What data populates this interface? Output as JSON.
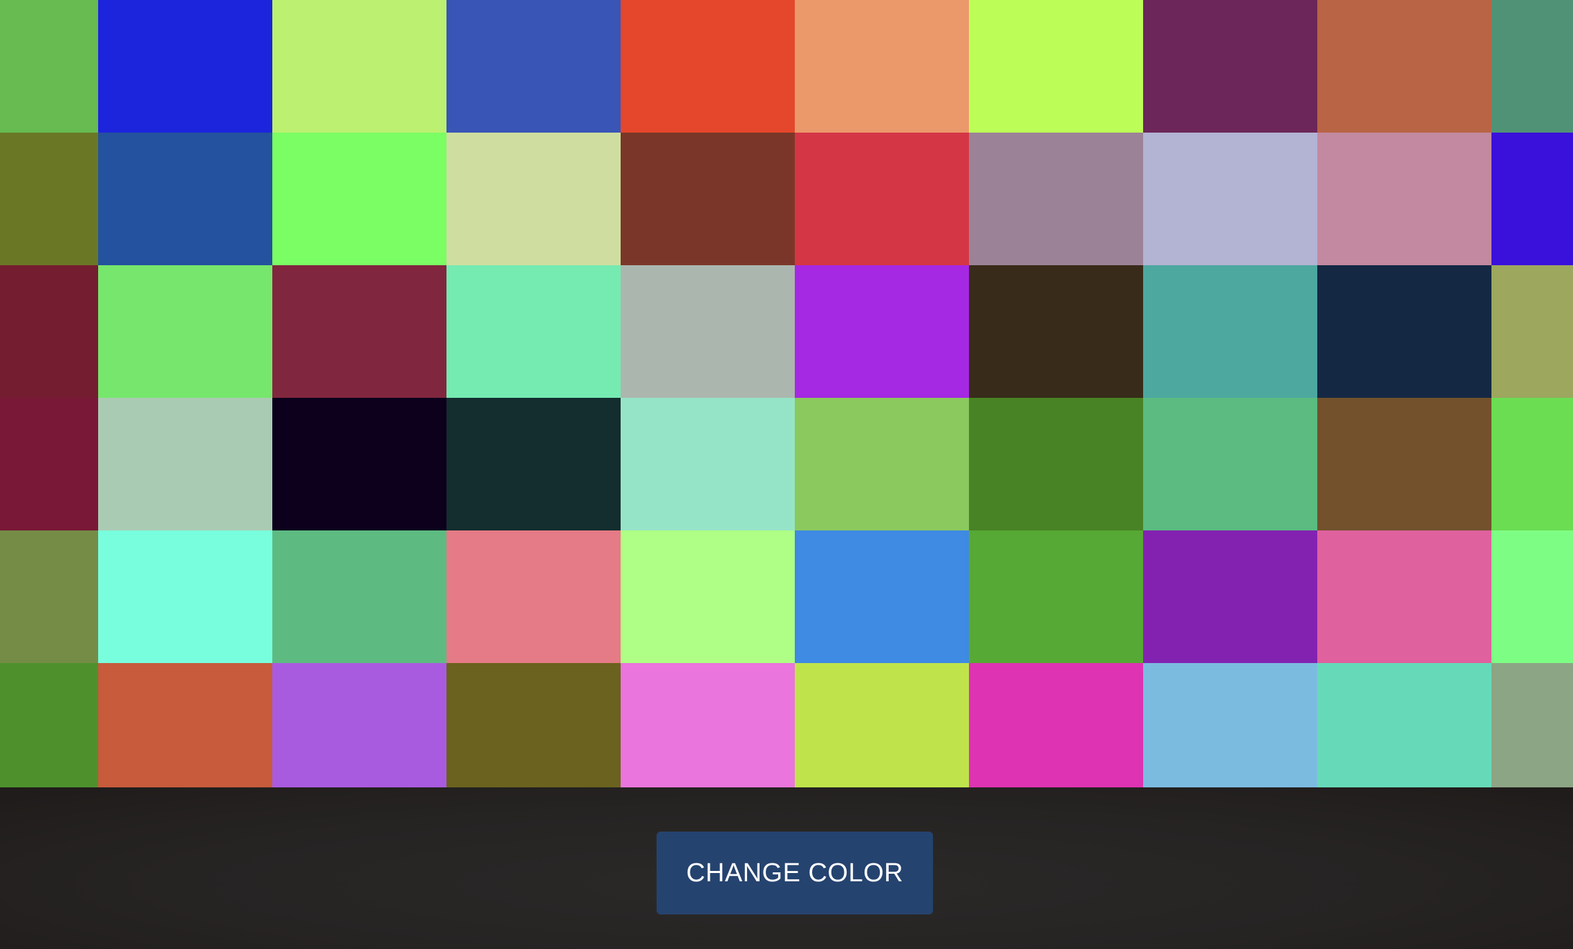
{
  "button": {
    "label": "CHANGE COLOR",
    "background": "#25436f",
    "text_color": "#ffffff"
  },
  "footer": {
    "background": "#262322"
  },
  "grid": {
    "rows": [
      [
        "#67bb51",
        "#1c24dc",
        "#bbf070",
        "#3955b6",
        "#e4472c",
        "#eb986b",
        "#bcfe57",
        "#6c2659",
        "#b86445",
        "#509275"
      ],
      [
        "#6a7826",
        "#24529e",
        "#7bfd64",
        "#cfdea0",
        "#7a3729",
        "#d53646",
        "#9c8297",
        "#b3b3d3",
        "#c289a0",
        "#3a10db"
      ],
      [
        "#751d30",
        "#77e66c",
        "#81263f",
        "#75eab1",
        "#abb7ae",
        "#a528e3",
        "#382b1a",
        "#4da8a0",
        "#142843",
        "#9da75e"
      ],
      [
        "#7a1837",
        "#aacbb3",
        "#0c001c",
        "#142d2f",
        "#96e4c7",
        "#8bc85e",
        "#488325",
        "#5bbb81",
        "#72512c",
        "#6bdd53"
      ],
      [
        "#758c46",
        "#79fedd",
        "#5dbb82",
        "#e57b86",
        "#affe85",
        "#3f8ae2",
        "#56a934",
        "#8322b1",
        "#df619d",
        "#7efd85"
      ],
      [
        "#4e912c",
        "#c75b3b",
        "#a95bdf",
        "#6a621e",
        "#ea75dc",
        "#bfe44b",
        "#de33b2",
        "#7bbbe0",
        "#66dab8",
        "#8ca584"
      ]
    ]
  }
}
